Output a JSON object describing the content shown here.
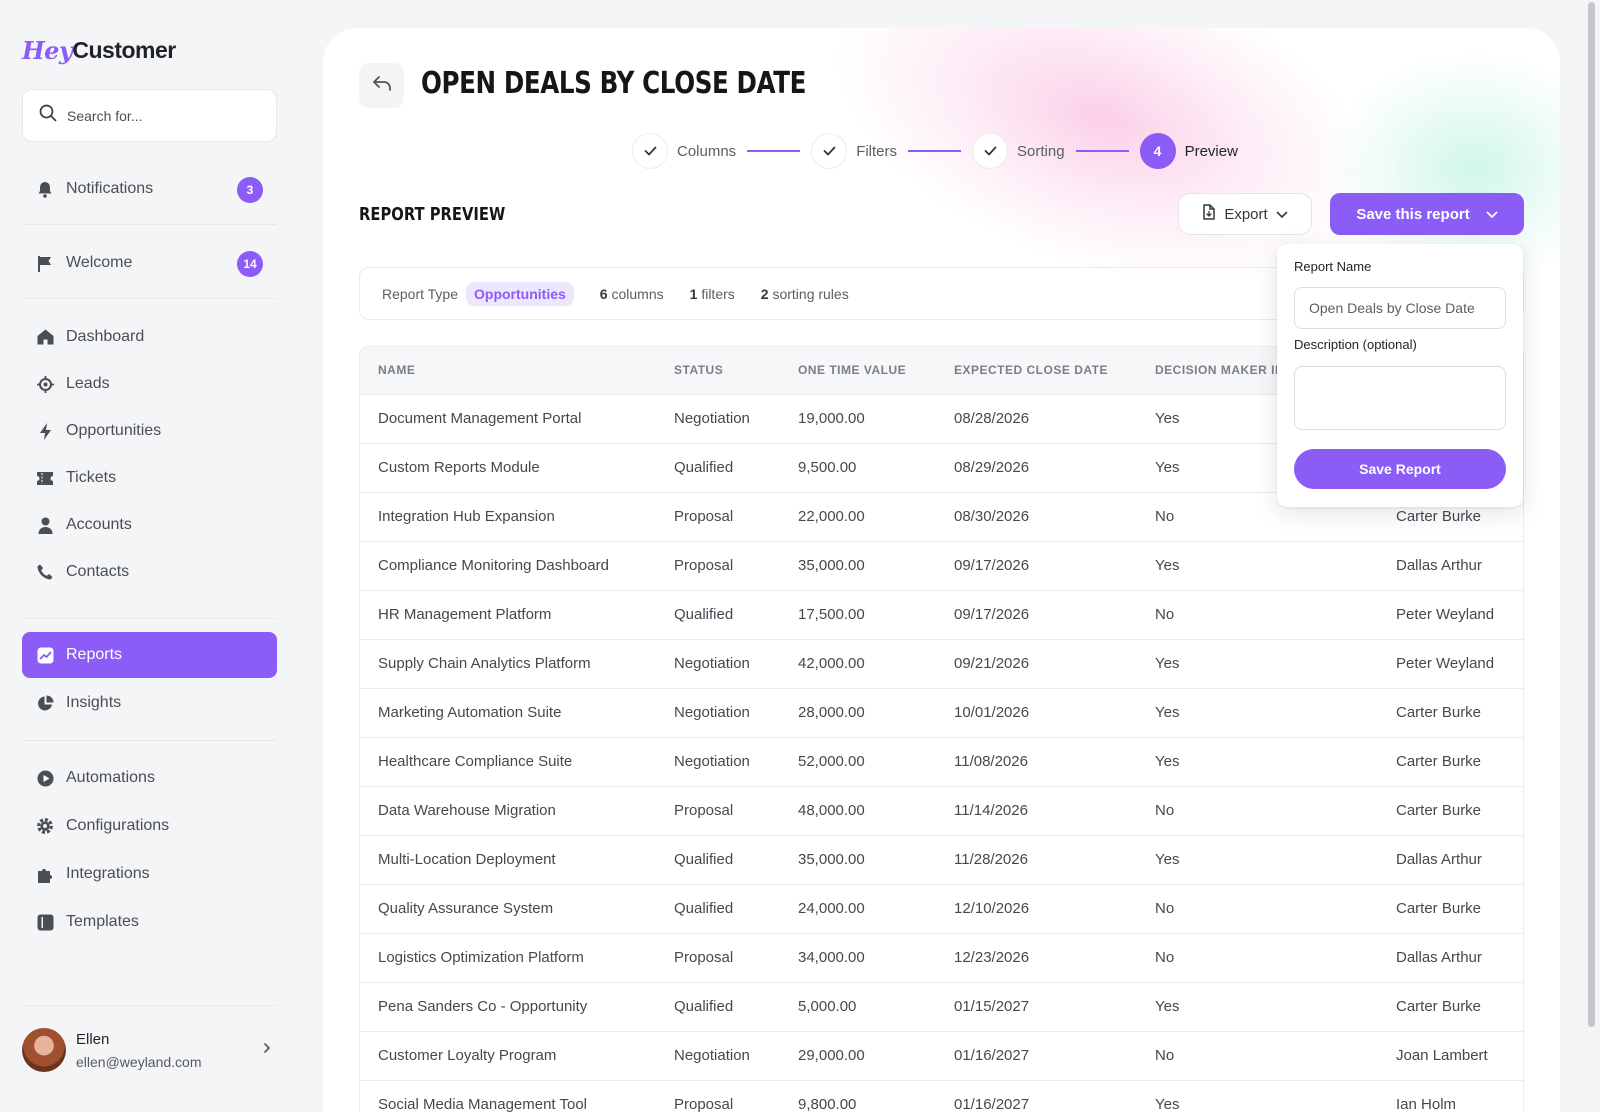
{
  "brand": {
    "logo_hey": "Hey",
    "logo_customer": "Customer",
    "accent": "#8b5cf6"
  },
  "search": {
    "placeholder": "Search for..."
  },
  "sidebar": {
    "items": [
      {
        "label": "Notifications",
        "badge": "3",
        "icon": "bell-icon"
      },
      {
        "label": "Welcome",
        "badge": "14",
        "icon": "flag-icon"
      },
      {
        "label": "Dashboard",
        "icon": "home-icon"
      },
      {
        "label": "Leads",
        "icon": "target-icon"
      },
      {
        "label": "Opportunities",
        "icon": "bolt-icon"
      },
      {
        "label": "Tickets",
        "icon": "ticket-icon"
      },
      {
        "label": "Accounts",
        "icon": "person-icon"
      },
      {
        "label": "Contacts",
        "icon": "phone-icon"
      },
      {
        "label": "Reports",
        "icon": "chart-icon",
        "active": true
      },
      {
        "label": "Insights",
        "icon": "pie-icon"
      },
      {
        "label": "Automations",
        "icon": "play-icon"
      },
      {
        "label": "Configurations",
        "icon": "gear-icon"
      },
      {
        "label": "Integrations",
        "icon": "puzzle-icon"
      },
      {
        "label": "Templates",
        "icon": "template-icon"
      }
    ]
  },
  "user": {
    "name": "Ellen",
    "email": "ellen@weyland.com"
  },
  "page": {
    "title": "OPEN DEALS BY CLOSE DATE",
    "section_title": "REPORT PREVIEW"
  },
  "steps": [
    {
      "label": "Columns",
      "state": "done"
    },
    {
      "label": "Filters",
      "state": "done"
    },
    {
      "label": "Sorting",
      "state": "done"
    },
    {
      "label": "Preview",
      "state": "current",
      "number": "4"
    }
  ],
  "toolbar": {
    "export_label": "Export",
    "save_label": "Save this report"
  },
  "meta": {
    "type_label": "Report Type",
    "type_value": "Opportunities",
    "columns_count": "6",
    "columns_text": "columns",
    "filters_count": "1",
    "filters_text": "filters",
    "sorting_count": "2",
    "sorting_text": "sorting rules"
  },
  "table": {
    "headers": [
      "NAME",
      "STATUS",
      "ONE TIME VALUE",
      "EXPECTED CLOSE DATE",
      "DECISION MAKER ID",
      ""
    ],
    "rows": [
      [
        "Document Management Portal",
        "Negotiation",
        "19,000.00",
        "08/28/2026",
        "Yes",
        ""
      ],
      [
        "Custom Reports Module",
        "Qualified",
        "9,500.00",
        "08/29/2026",
        "Yes",
        ""
      ],
      [
        "Integration Hub Expansion",
        "Proposal",
        "22,000.00",
        "08/30/2026",
        "No",
        "Carter Burke"
      ],
      [
        "Compliance Monitoring Dashboard",
        "Proposal",
        "35,000.00",
        "09/17/2026",
        "Yes",
        "Dallas Arthur"
      ],
      [
        "HR Management Platform",
        "Qualified",
        "17,500.00",
        "09/17/2026",
        "No",
        "Peter Weyland"
      ],
      [
        "Supply Chain Analytics Platform",
        "Negotiation",
        "42,000.00",
        "09/21/2026",
        "Yes",
        "Peter Weyland"
      ],
      [
        "Marketing Automation Suite",
        "Negotiation",
        "28,000.00",
        "10/01/2026",
        "Yes",
        "Carter Burke"
      ],
      [
        "Healthcare Compliance Suite",
        "Negotiation",
        "52,000.00",
        "11/08/2026",
        "Yes",
        "Carter Burke"
      ],
      [
        "Data Warehouse Migration",
        "Proposal",
        "48,000.00",
        "11/14/2026",
        "No",
        "Carter Burke"
      ],
      [
        "Multi-Location Deployment",
        "Qualified",
        "35,000.00",
        "11/28/2026",
        "Yes",
        "Dallas Arthur"
      ],
      [
        "Quality Assurance System",
        "Qualified",
        "24,000.00",
        "12/10/2026",
        "No",
        "Carter Burke"
      ],
      [
        "Logistics Optimization Platform",
        "Proposal",
        "34,000.00",
        "12/23/2026",
        "No",
        "Dallas Arthur"
      ],
      [
        "Pena Sanders Co - Opportunity",
        "Qualified",
        "5,000.00",
        "01/15/2027",
        "Yes",
        "Carter Burke"
      ],
      [
        "Customer Loyalty Program",
        "Negotiation",
        "29,000.00",
        "01/16/2027",
        "No",
        "Joan Lambert"
      ],
      [
        "Social Media Management Tool",
        "Proposal",
        "9,800.00",
        "01/16/2027",
        "Yes",
        "Ian Holm"
      ]
    ]
  },
  "popover": {
    "name_label": "Report Name",
    "name_value": "Open Deals by Close Date",
    "description_label": "Description (optional)",
    "description_value": "",
    "save_label": "Save Report"
  }
}
